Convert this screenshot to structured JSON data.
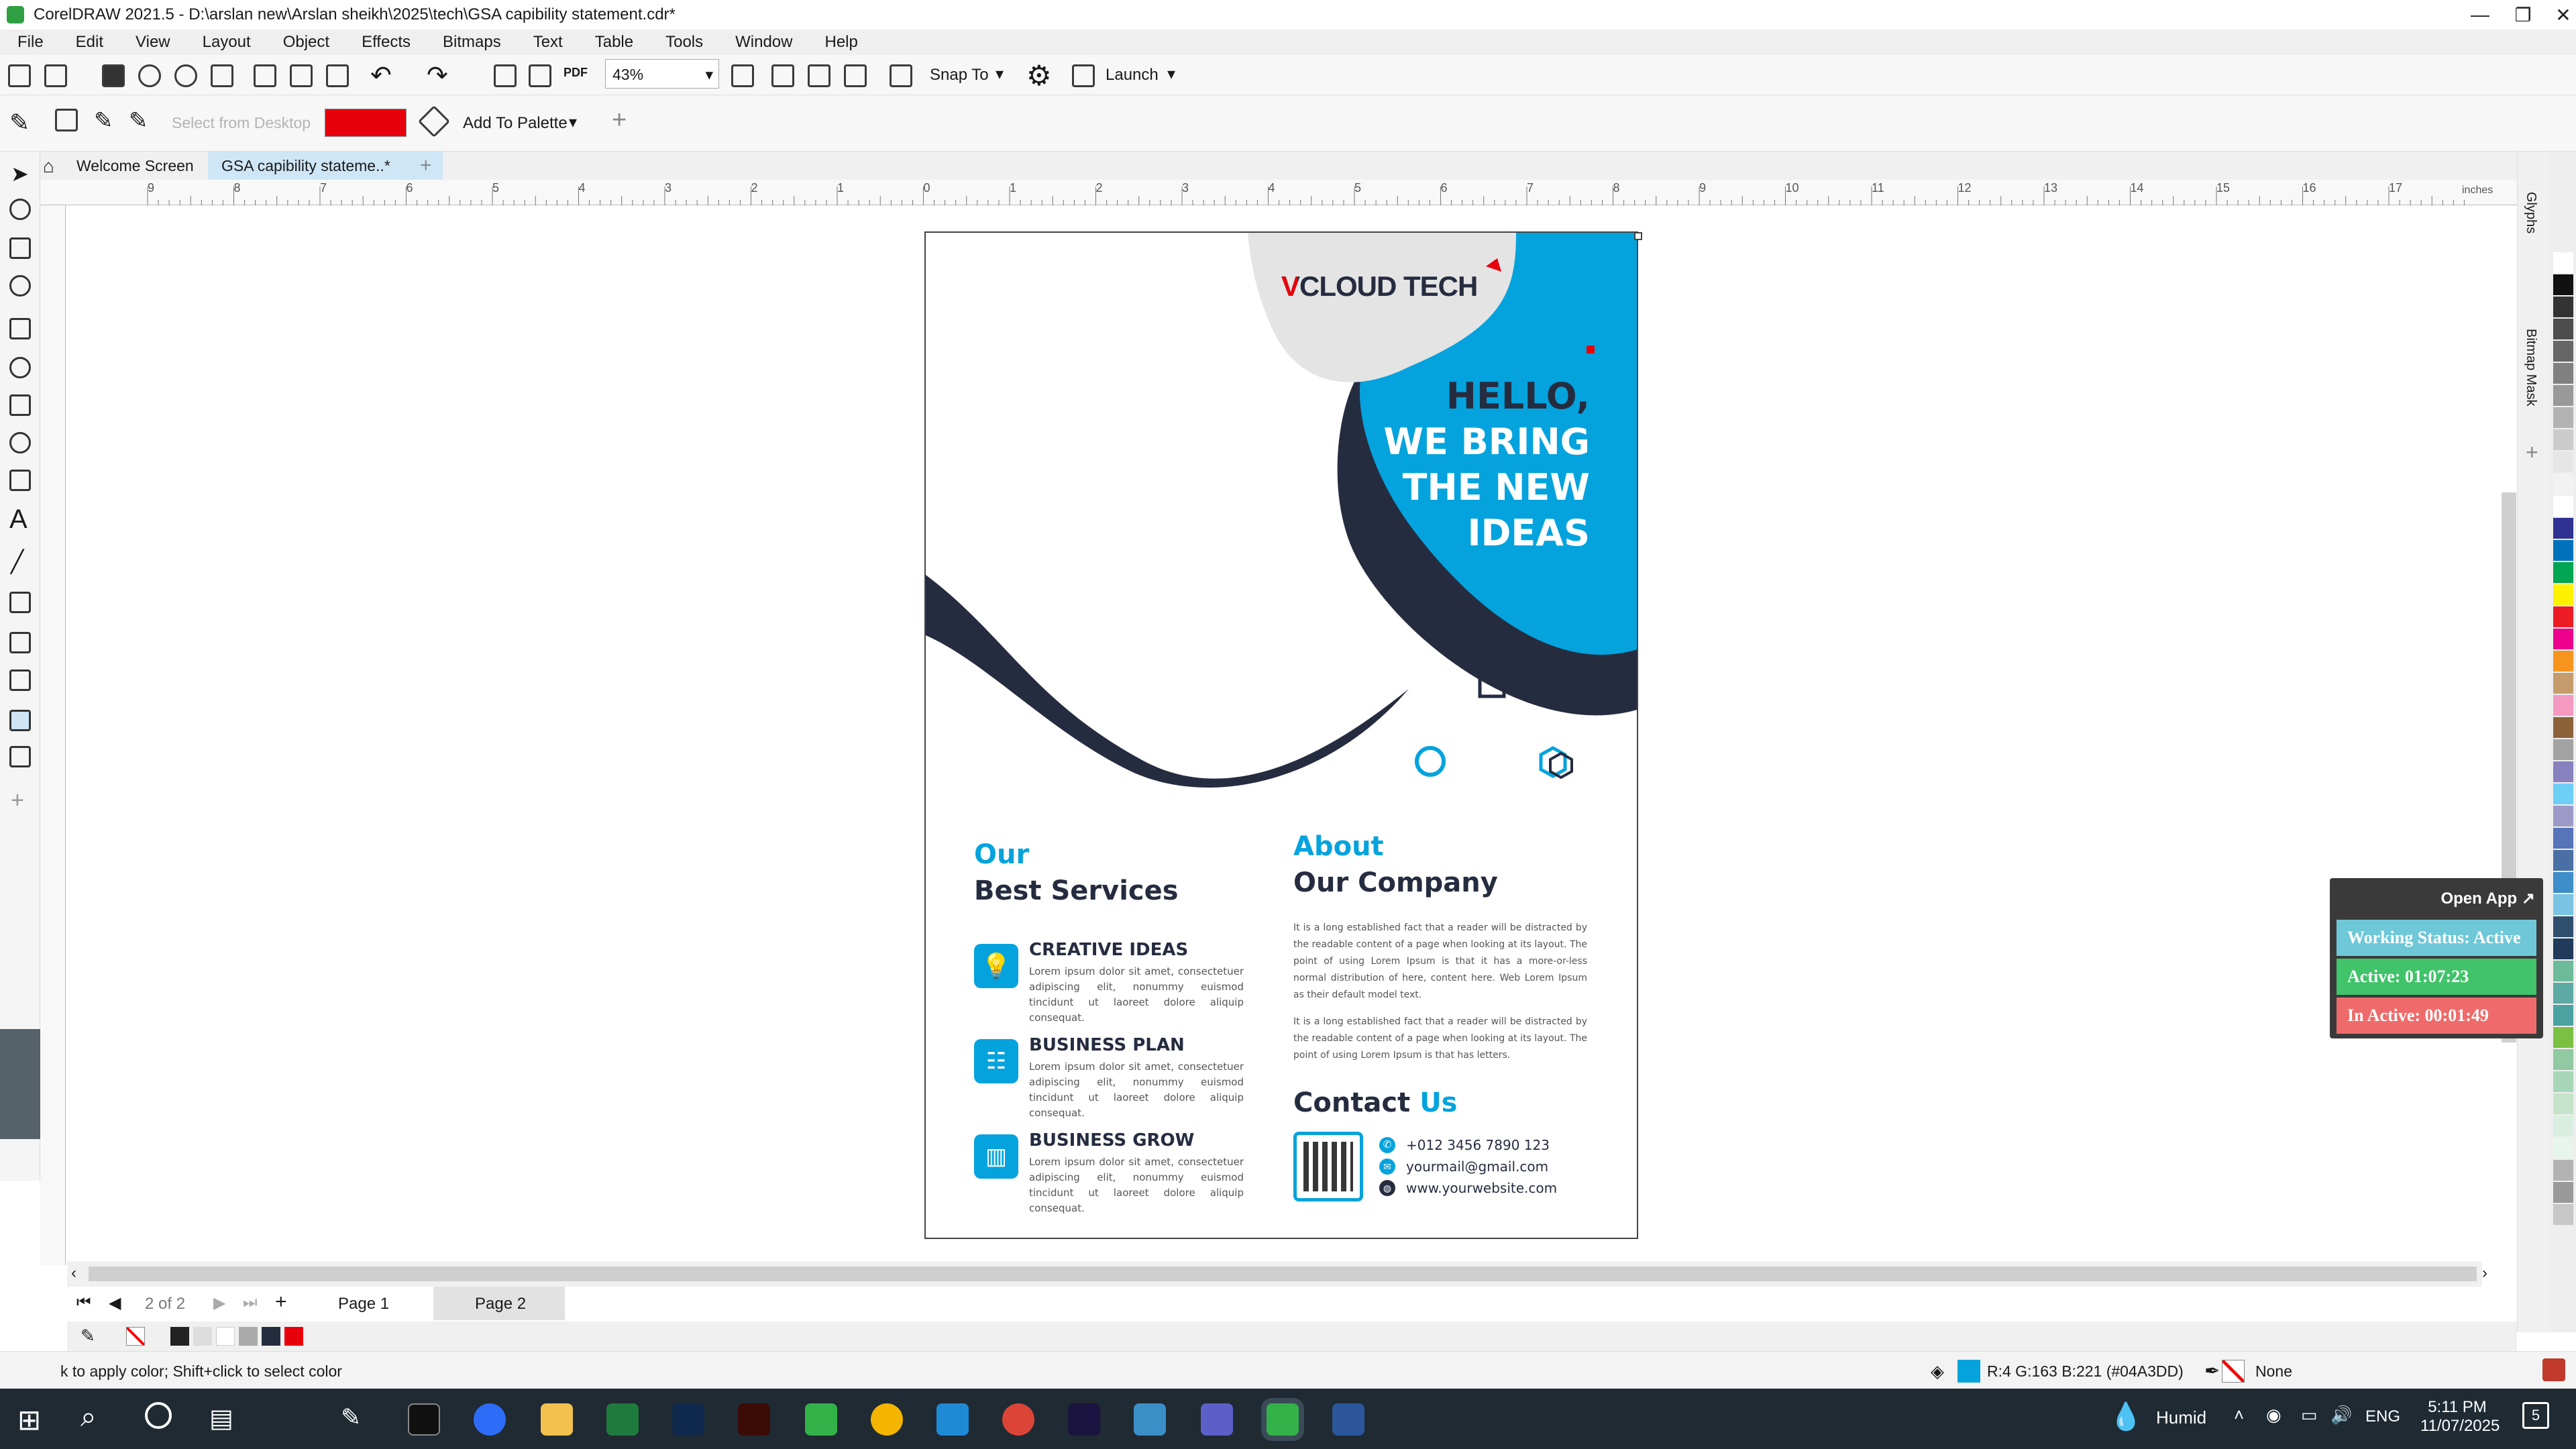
{
  "window": {
    "title": "CorelDRAW 2021.5 - D:\\arslan new\\Arslan sheikh\\2025\\tech\\GSA  capibility statement.cdr*"
  },
  "menu": [
    "File",
    "Edit",
    "View",
    "Layout",
    "Object",
    "Effects",
    "Bitmaps",
    "Text",
    "Table",
    "Tools",
    "Window",
    "Help"
  ],
  "toolbar": {
    "zoom": "43%",
    "snap_label": "Snap To",
    "launch_label": "Launch"
  },
  "property_bar": {
    "select_from_desktop": "Select from Desktop",
    "add_to_palette": "Add To Palette",
    "color": "#e8000d"
  },
  "tabs": [
    {
      "label": "Welcome Screen"
    },
    {
      "label": "GSA  capibility stateme..*"
    }
  ],
  "ruler": {
    "marks": [
      "9",
      "8",
      "7",
      "6",
      "5",
      "4",
      "3",
      "2",
      "1",
      "0",
      "1",
      "2",
      "3",
      "4",
      "5",
      "6",
      "7",
      "8",
      "9",
      "10",
      "11",
      "12",
      "13",
      "14",
      "15",
      "16",
      "17"
    ],
    "unit": "inches"
  },
  "docker_tabs": [
    "Glyphs",
    "Bitmap Mask"
  ],
  "flyer": {
    "logo": "VCLOUD TECH",
    "headline": [
      "HELLO,",
      "WE BRING",
      "THE NEW",
      "IDEAS"
    ],
    "services_title_1": "Our",
    "services_title_2": "Best Services",
    "services": [
      {
        "title_bold": "CREATIVE",
        "title_rest": " IDEAS",
        "text": "Lorem ipsum dolor sit amet, consectetuer adipiscing elit, nonummy euismod tincidunt ut laoreet dolore aliquip consequat."
      },
      {
        "title_bold": "BUSINESS",
        "title_rest": " PLAN",
        "text": "Lorem ipsum dolor sit amet, consectetuer adipiscing elit, nonummy euismod tincidunt ut laoreet dolore aliquip consequat."
      },
      {
        "title_bold": "BUSINESS",
        "title_rest": " GROW",
        "text": "Lorem ipsum dolor sit amet, consectetuer adipiscing elit, nonummy euismod tincidunt ut laoreet dolore aliquip consequat."
      }
    ],
    "about_title_1": "About",
    "about_title_2": "Our Company",
    "about_p1": "It is a long established fact that a reader will be distracted by the readable content of a page when looking at its layout. The point of using Lorem Ipsum is that it has a more-or-less normal distribution of here, content here. Web Lorem Ipsum as their default model text.",
    "about_p2": "It is a long established fact that a reader will be distracted by the readable content of a page when looking at its layout. The point of using Lorem Ipsum is that has letters.",
    "contact_title_1": "Contact",
    "contact_title_2": "Us",
    "phone": "+012 3456 7890 123",
    "email": "yourmail@gmail.com",
    "website": "www.yourwebsite.com",
    "colors": {
      "blue": "#04A3DD",
      "navy": "#262c40",
      "grey": "#e4e4e4",
      "red": "#e8000d"
    }
  },
  "widget": {
    "open_app": "Open App ↗",
    "working_status": "Working Status: Active",
    "active": "Active: 01:07:23",
    "inactive": "In Active: 00:01:49"
  },
  "pages": {
    "counter": "2 of 2",
    "page1": "Page 1",
    "page2": "Page 2"
  },
  "status": {
    "hint": "k to apply color; Shift+click to select color",
    "fill": "R:4 G:163 B:221 (#04A3DD)",
    "outline": "None"
  },
  "taskbar": {
    "weather": "Humid",
    "lang": "ENG",
    "time": "5:11 PM",
    "date": "11/07/2025",
    "notifications": "5"
  }
}
